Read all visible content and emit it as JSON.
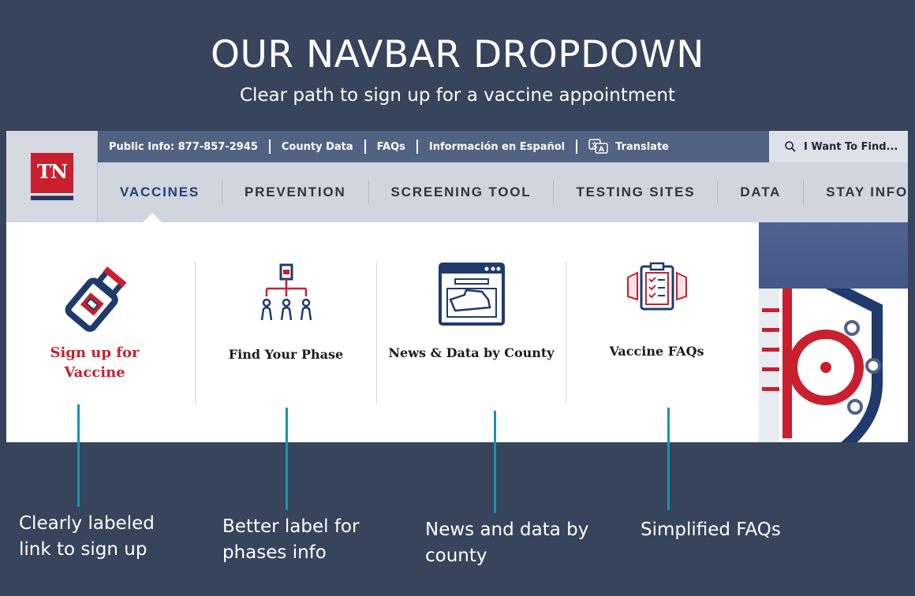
{
  "header": {
    "title": "OUR NAVBAR DROPDOWN",
    "subtitle": "Clear path to sign up for a vaccine appointment"
  },
  "site": {
    "logo_text": "TN",
    "utility": {
      "phone": "Public Info: 877-857-2945",
      "county_data": "County Data",
      "faqs": "FAQs",
      "spanish": "Información en Español",
      "translate": "Translate",
      "find": "I Want To Find..."
    },
    "nav": [
      "VACCINES",
      "PREVENTION",
      "SCREENING TOOL",
      "TESTING SITES",
      "DATA",
      "STAY INFORMED"
    ],
    "active_nav": "VACCINES",
    "dropdown": {
      "sign_up": "Sign up for Vaccine",
      "find_phase": "Find Your Phase",
      "news_data": "News & Data by County",
      "faqs": "Vaccine FAQs"
    }
  },
  "annotations": {
    "sign_up": "Clearly labeled link to sign up",
    "phase": "Better label for phases info",
    "news": "News and data by county",
    "faqs": "Simplified FAQs"
  },
  "colors": {
    "background": "#37445b",
    "accent_red": "#c8202f",
    "navy": "#203b6b",
    "pointer": "#1a93b3"
  },
  "icons": [
    "search-icon",
    "translate-icon",
    "vaccine-vial-icon",
    "phase-people-icon",
    "county-map-icon",
    "faq-clipboard-icon"
  ]
}
